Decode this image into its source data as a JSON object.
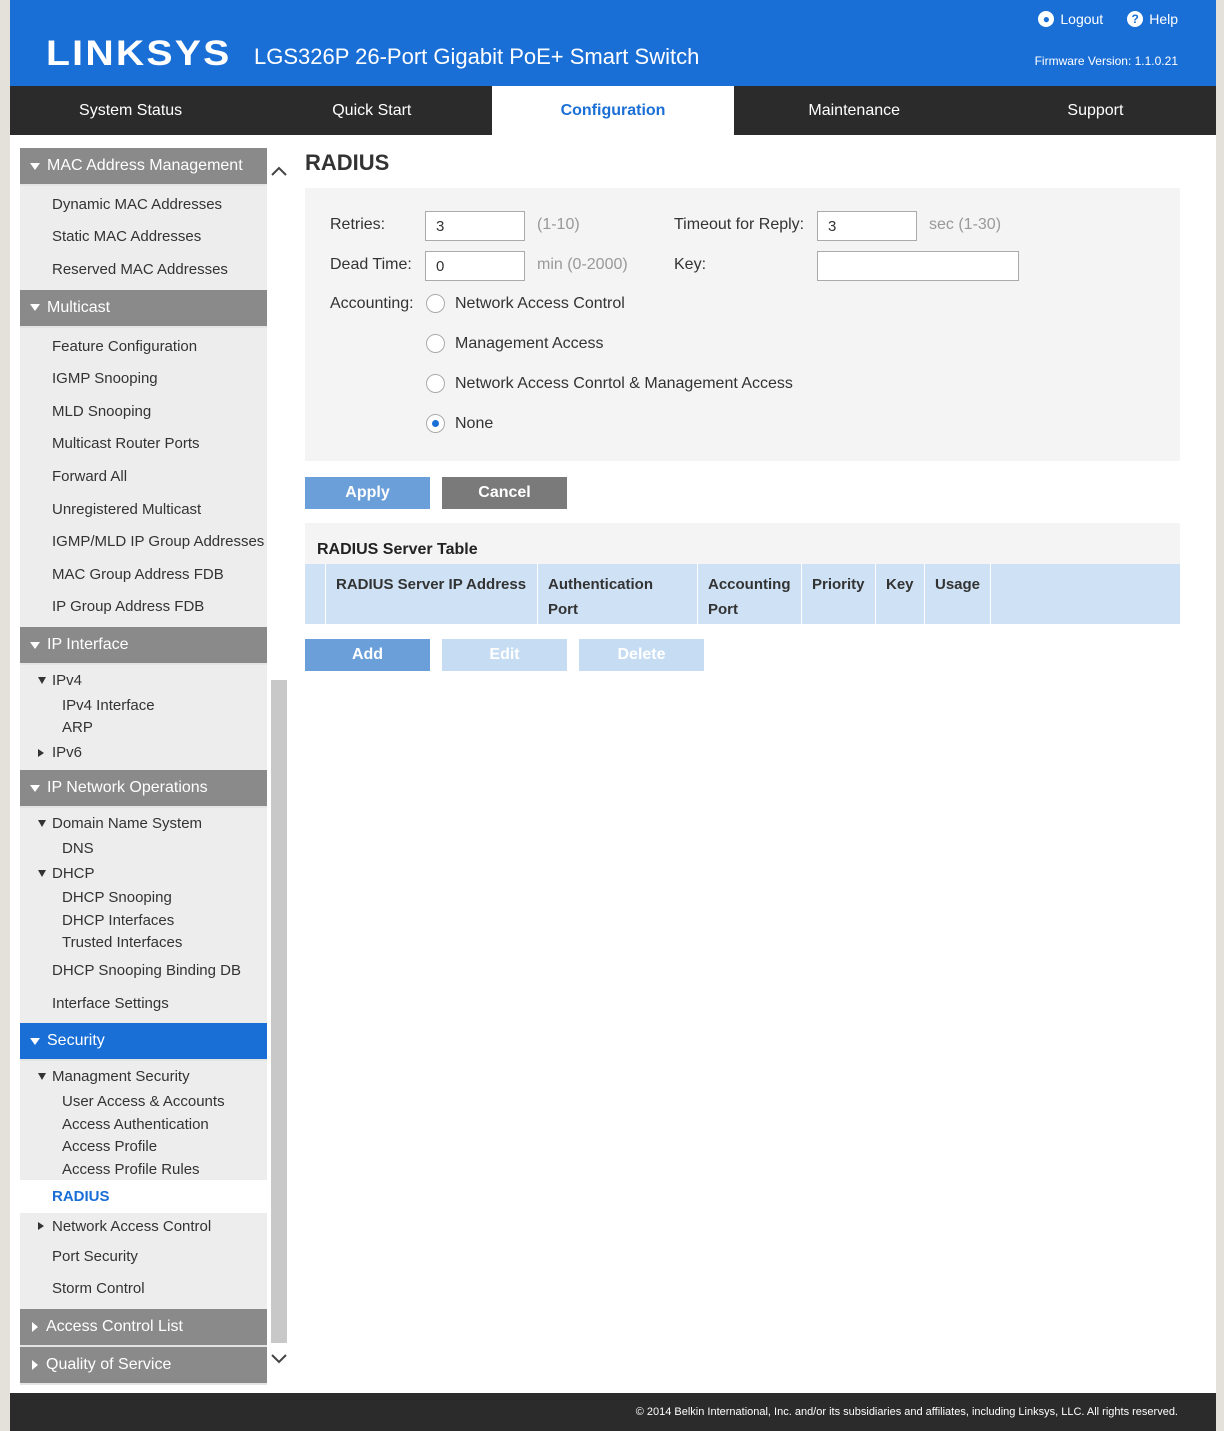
{
  "header": {
    "logo": "LINKSYS",
    "product": "LGS326P 26-Port Gigabit PoE+ Smart Switch",
    "logout": "Logout",
    "help": "Help",
    "firmware": "Firmware Version: 1.1.0.21"
  },
  "nav": {
    "tabs": [
      "System Status",
      "Quick Start",
      "Configuration",
      "Maintenance",
      "Support"
    ],
    "active": "Configuration"
  },
  "sidebar": {
    "mac": {
      "title": "MAC Address Management",
      "items": [
        "Dynamic MAC Addresses",
        "Static MAC Addresses",
        "Reserved MAC Addresses"
      ]
    },
    "multicast": {
      "title": "Multicast",
      "items": [
        "Feature Configuration",
        "IGMP Snooping",
        "MLD Snooping",
        "Multicast Router Ports",
        "Forward All",
        "Unregistered Multicast",
        "IGMP/MLD IP Group Addresses",
        "MAC Group Address FDB",
        "IP Group Address FDB"
      ]
    },
    "ipinterface": {
      "title": "IP Interface",
      "ipv4": "IPv4",
      "ipv4_items": [
        "IPv4 Interface",
        "ARP"
      ],
      "ipv6": "IPv6"
    },
    "ipnet": {
      "title": "IP Network Operations",
      "dns_parent": "Domain Name System",
      "dns": "DNS",
      "dhcp": "DHCP",
      "dhcp_items": [
        "DHCP Snooping",
        "DHCP Interfaces",
        "Trusted Interfaces"
      ],
      "items": [
        "DHCP Snooping Binding DB",
        "Interface Settings"
      ]
    },
    "security": {
      "title": "Security",
      "mgmt": "Managment Security",
      "mgmt_items": [
        "User Access & Accounts",
        "Access Authentication",
        "Access Profile",
        "Access Profile Rules"
      ],
      "radius": "RADIUS",
      "nac": "Network Access Control",
      "items": [
        "Port Security",
        "Storm Control"
      ]
    },
    "acl": {
      "title": "Access Control List"
    },
    "qos": {
      "title": "Quality of Service"
    }
  },
  "main": {
    "title": "RADIUS",
    "retries_label": "Retries:",
    "retries_value": "3",
    "retries_hint": "(1-10)",
    "timeout_label": "Timeout for Reply:",
    "timeout_value": "3",
    "timeout_hint": "sec (1-30)",
    "deadtime_label": "Dead Time:",
    "deadtime_value": "0",
    "deadtime_hint": "min (0-2000)",
    "key_label": "Key:",
    "key_value": "",
    "accounting_label": "Accounting:",
    "accounting_options": [
      "Network Access Control",
      "Management Access",
      "Network Access Conrtol & Management Access",
      "None"
    ],
    "accounting_selected": "None",
    "apply": "Apply",
    "cancel": "Cancel",
    "table_title": "RADIUS Server Table",
    "columns": [
      "RADIUS Server IP Address",
      "Authentication Port",
      "Accounting Port",
      "Priority",
      "Key",
      "Usage"
    ],
    "add": "Add",
    "edit": "Edit",
    "delete": "Delete"
  },
  "footer": {
    "copyright": "© 2014 Belkin International, Inc. and/or its subsidiaries and affiliates, including Linksys, LLC. All rights reserved."
  }
}
